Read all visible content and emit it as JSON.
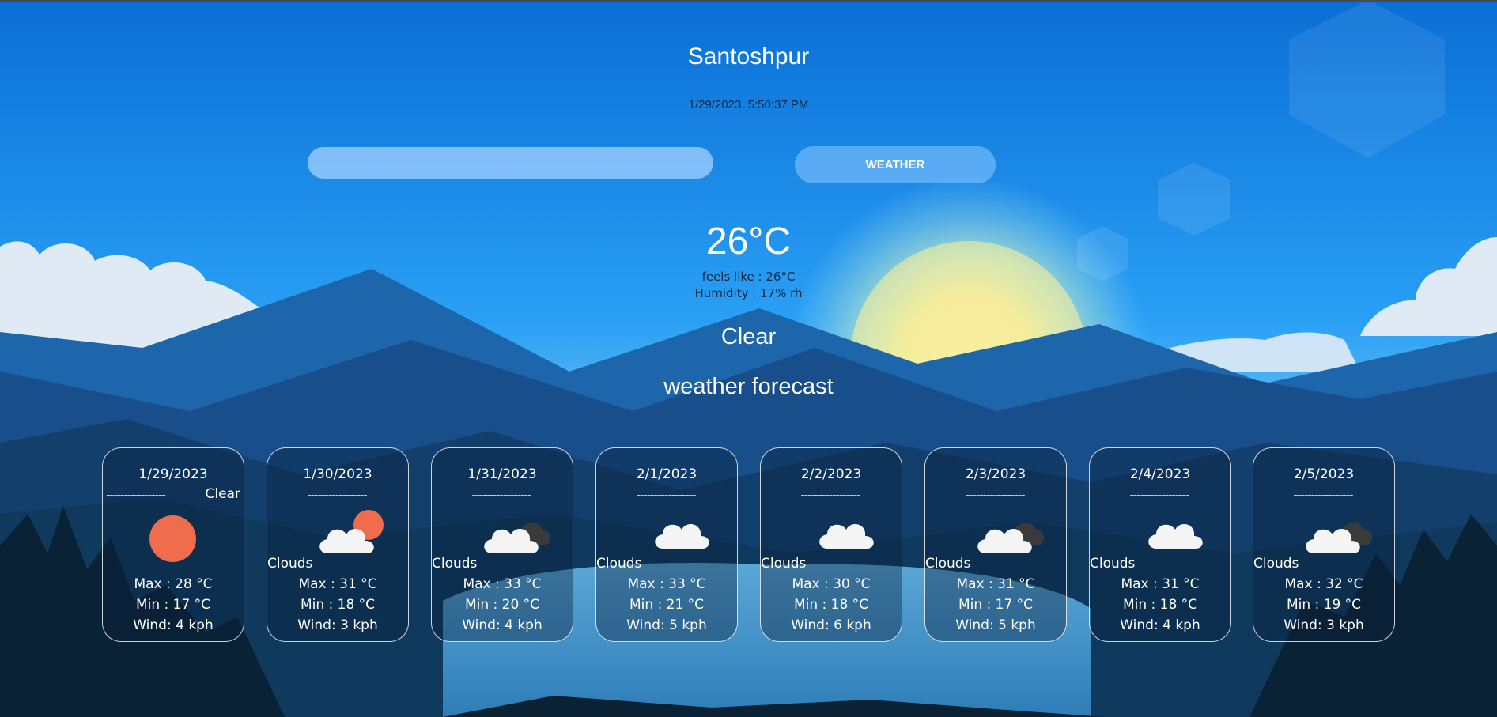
{
  "header": {
    "city": "Santoshpur",
    "datetime": "1/29/2023, 5:50:37 PM"
  },
  "search": {
    "value": "",
    "placeholder": "",
    "button_label": "WEATHER"
  },
  "current": {
    "temperature": "26°C",
    "feels_like": "feels like : 26°C",
    "humidity": "Humidity : 17% rh",
    "condition": "Clear"
  },
  "forecast_title": "weather forecast",
  "forecast": [
    {
      "date": "1/29/2023",
      "dashes": "-----------------",
      "desc": "Clear",
      "icon": "sun-icon",
      "max": "Max : 28 °C",
      "min": "Min : 17 °C",
      "wind": "Wind: 4 kph"
    },
    {
      "date": "1/30/2023",
      "dashes": "-----------------",
      "desc": "Clouds",
      "icon": "cloud-sun-icon",
      "max": "Max : 31 °C",
      "min": "Min : 18 °C",
      "wind": "Wind: 3 kph"
    },
    {
      "date": "1/31/2023",
      "dashes": "-----------------",
      "desc": "Clouds",
      "icon": "broken-clouds-icon",
      "max": "Max : 33 °C",
      "min": "Min : 20 °C",
      "wind": "Wind: 4 kph"
    },
    {
      "date": "2/1/2023",
      "dashes": "-----------------",
      "desc": "Clouds",
      "icon": "cloud-icon",
      "max": "Max : 33 °C",
      "min": "Min : 21 °C",
      "wind": "Wind: 5 kph"
    },
    {
      "date": "2/2/2023",
      "dashes": "-----------------",
      "desc": "Clouds",
      "icon": "cloud-icon",
      "max": "Max : 30 °C",
      "min": "Min : 18 °C",
      "wind": "Wind: 6 kph"
    },
    {
      "date": "2/3/2023",
      "dashes": "-----------------",
      "desc": "Clouds",
      "icon": "broken-clouds-icon",
      "max": "Max : 31 °C",
      "min": "Min : 17 °C",
      "wind": "Wind: 5 kph"
    },
    {
      "date": "2/4/2023",
      "dashes": "-----------------",
      "desc": "Clouds",
      "icon": "cloud-icon",
      "max": "Max : 31 °C",
      "min": "Min : 18 °C",
      "wind": "Wind: 4 kph"
    },
    {
      "date": "2/5/2023",
      "dashes": "-----------------",
      "desc": "Clouds",
      "icon": "broken-clouds-icon",
      "max": "Max : 32 °C",
      "min": "Min : 19 °C",
      "wind": "Wind: 3 kph"
    }
  ],
  "colors": {
    "sky_top": "#0a6fd6",
    "sky_mid": "#2aa0f5",
    "sun_glow": "#f4ec9a",
    "sun_icon": "#ef6d4c",
    "mountain_dark": "#0f3a5e"
  }
}
